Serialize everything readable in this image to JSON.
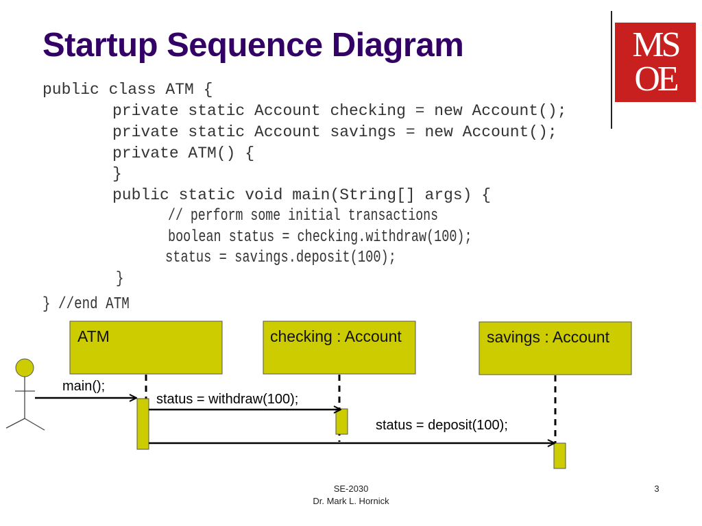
{
  "slide": {
    "title": "Startup Sequence Diagram",
    "logo_text": [
      "MS",
      "OE"
    ],
    "brand_color": "#c8201f",
    "title_color": "#330066",
    "object_fill_color": "#cccc00"
  },
  "code": {
    "lines": [
      "public class ATM {",
      "private static Account checking = new Account();",
      "private static Account savings = new Account();",
      "private ATM() {",
      "}",
      "public static void main(String[] args) {",
      "// perform some initial transactions",
      "boolean status = checking.withdraw(100);",
      "status = savings.deposit(100);",
      "}",
      "} //end ATM"
    ]
  },
  "diagram": {
    "actor": "user",
    "objects": [
      {
        "label": "ATM"
      },
      {
        "label": "checking : Account"
      },
      {
        "label": "savings : Account"
      }
    ],
    "messages": [
      {
        "label": "main();",
        "from": "actor",
        "to": "ATM"
      },
      {
        "label": "status = withdraw(100);",
        "from": "ATM",
        "to": "checking : Account"
      },
      {
        "label": "status = deposit(100);",
        "from": "ATM",
        "to": "savings : Account"
      }
    ]
  },
  "footer": {
    "course": "SE-2030",
    "author": "Dr. Mark L. Hornick",
    "page_number": "3"
  }
}
